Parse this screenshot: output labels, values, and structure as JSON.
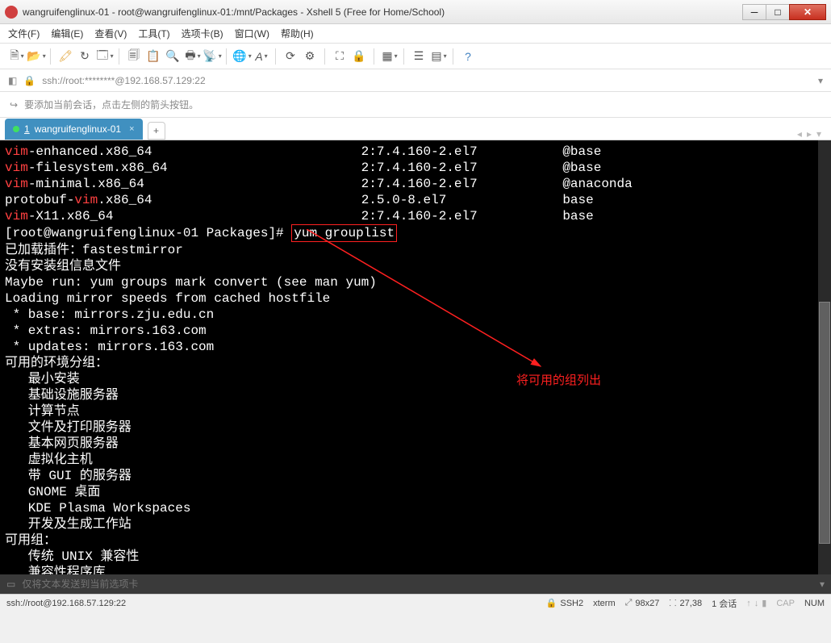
{
  "window": {
    "title": "wangruifenglinux-01 - root@wangruifenglinux-01:/mnt/Packages - Xshell 5 (Free for Home/School)"
  },
  "menu": {
    "file": "文件(F)",
    "edit": "编辑(E)",
    "view": "查看(V)",
    "tools": "工具(T)",
    "tabs": "选项卡(B)",
    "window": "窗口(W)",
    "help": "帮助(H)"
  },
  "address": {
    "url": "ssh://root:********@192.168.57.129:22"
  },
  "hint": {
    "text": "要添加当前会话，点击左侧的箭头按钮。"
  },
  "tab": {
    "num": "1",
    "label": "wangruifenglinux-01",
    "add": "+"
  },
  "terminal": {
    "packages": [
      {
        "name_red": "vim",
        "name_rest": "-enhanced.x86_64",
        "ver": "2:7.4.160-2.el7",
        "repo": "@base"
      },
      {
        "name_red": "vim",
        "name_rest": "-filesystem.x86_64",
        "ver": "2:7.4.160-2.el7",
        "repo": "@base"
      },
      {
        "name_red": "vim",
        "name_rest": "-minimal.x86_64",
        "ver": "2:7.4.160-2.el7",
        "repo": "@anaconda"
      },
      {
        "name_red": "vim",
        "name_rest": ".x86_64",
        "prefix": "protobuf-",
        "ver": "2.5.0-8.el7",
        "repo": "base"
      },
      {
        "name_red": "vim",
        "name_rest": "-X11.x86_64",
        "ver": "2:7.4.160-2.el7",
        "repo": "base"
      }
    ],
    "prompt": "[root@wangruifenglinux-01 Packages]# ",
    "command": "yum grouplist",
    "l_plugin": "已加载插件：fastestmirror",
    "l_nogroup": "没有安装组信息文件",
    "l_maybe": "Maybe run: yum groups mark convert (see man yum)",
    "l_loading": "Loading mirror speeds from cached hostfile",
    "l_base": " * base: mirrors.zju.edu.cn",
    "l_extras": " * extras: mirrors.163.com",
    "l_updates": " * updates: mirrors.163.com",
    "l_envhdr": "可用的环境分组：",
    "env": [
      "最小安装",
      "基础设施服务器",
      "计算节点",
      "文件及打印服务器",
      "基本网页服务器",
      "虚拟化主机",
      "带 GUI 的服务器",
      "GNOME 桌面",
      "KDE Plasma Workspaces",
      "开发及生成工作站"
    ],
    "l_grouphdr": "可用组：",
    "grp": [
      "传统 UNIX 兼容性",
      "兼容性程序库"
    ],
    "annotation": "将可用的组列出"
  },
  "editbar": {
    "placeholder": "仅将文本发送到当前选项卡"
  },
  "status": {
    "left": "ssh://root@192.168.57.129:22",
    "ssh": "SSH2",
    "term": "xterm",
    "size_icon": "⤢",
    "size": "98x27",
    "pos_icon": "⸬",
    "pos": "27,38",
    "sess": "1 会话",
    "cap": "CAP",
    "num": "NUM"
  }
}
